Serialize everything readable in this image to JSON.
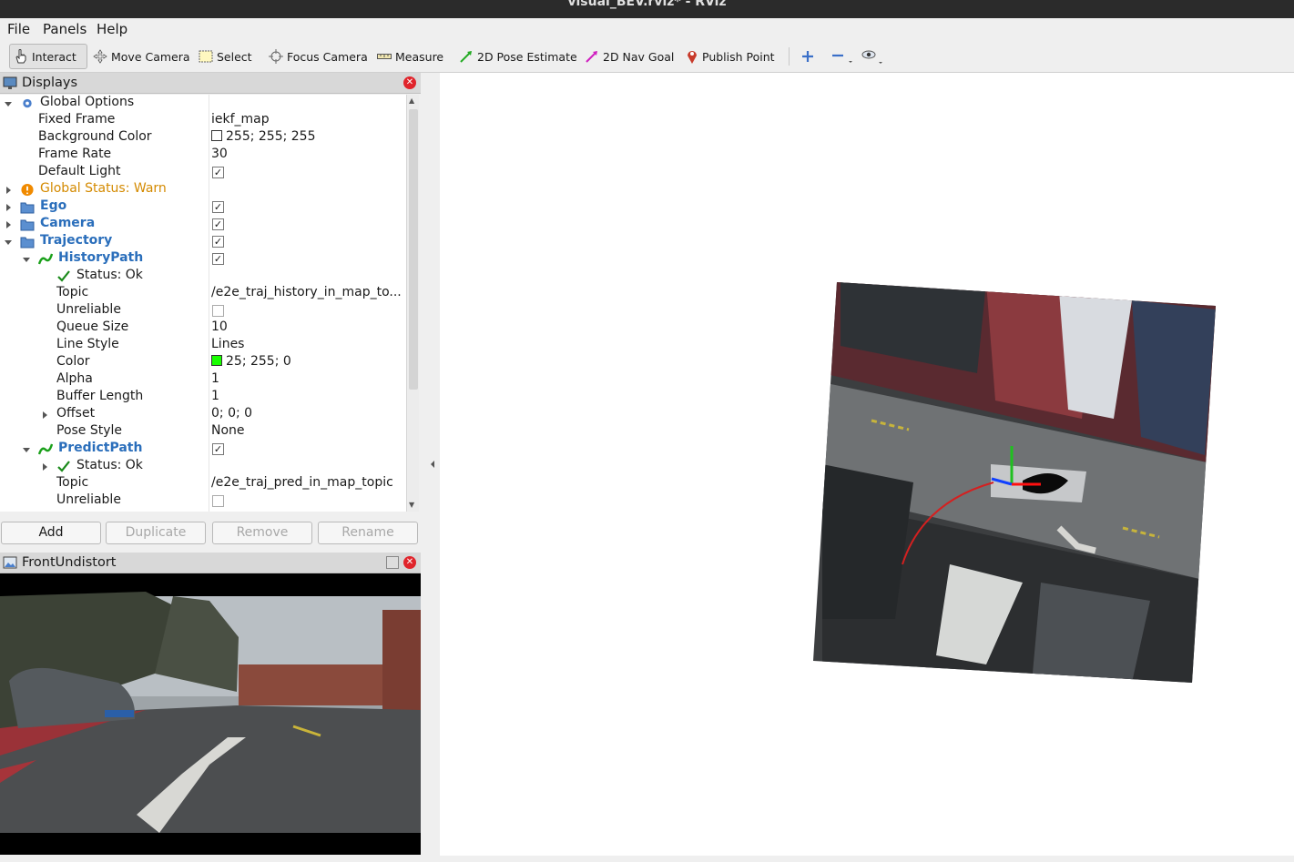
{
  "window": {
    "title": "visual_BEV.rviz* - RViz"
  },
  "menubar": {
    "items": [
      "File",
      "Panels",
      "Help"
    ]
  },
  "toolbar": {
    "interact": "Interact",
    "move_camera": "Move Camera",
    "select": "Select",
    "focus_camera": "Focus Camera",
    "measure": "Measure",
    "pose_estimate": "2D Pose Estimate",
    "nav_goal": "2D Nav Goal",
    "publish_point": "Publish Point"
  },
  "displays": {
    "title": "Displays",
    "rows": {
      "global_options": "Global Options",
      "fixed_frame": "Fixed Frame",
      "fixed_frame_val": "iekf_map",
      "background_color": "Background Color",
      "background_color_val": "255; 255; 255",
      "frame_rate": "Frame Rate",
      "frame_rate_val": "30",
      "default_light": "Default Light",
      "global_status": "Global Status: Warn",
      "ego": "Ego",
      "camera": "Camera",
      "trajectory": "Trajectory",
      "history_path": "HistoryPath",
      "status_ok": "Status: Ok",
      "topic": "Topic",
      "history_topic_val": "/e2e_traj_history_in_map_to...",
      "unreliable": "Unreliable",
      "queue_size": "Queue Size",
      "queue_size_val": "10",
      "line_style": "Line Style",
      "line_style_val": "Lines",
      "color": "Color",
      "color_val": "25; 255; 0",
      "alpha": "Alpha",
      "alpha_val": "1",
      "buffer_length": "Buffer Length",
      "buffer_length_val": "1",
      "offset": "Offset",
      "offset_val": "0; 0; 0",
      "pose_style": "Pose Style",
      "pose_style_val": "None",
      "predict_path": "PredictPath",
      "predict_status_ok": "Status: Ok",
      "predict_topic": "Topic",
      "predict_topic_val": "/e2e_traj_pred_in_map_topic",
      "predict_unreliable": "Unreliable"
    },
    "colors": {
      "path_color": "#19ff00",
      "warn": "#d48a00",
      "link": "#2a6ebb"
    },
    "buttons": {
      "add": "Add",
      "duplicate": "Duplicate",
      "remove": "Remove",
      "rename": "Rename"
    }
  },
  "image_panel": {
    "title": "FrontUndistort"
  }
}
